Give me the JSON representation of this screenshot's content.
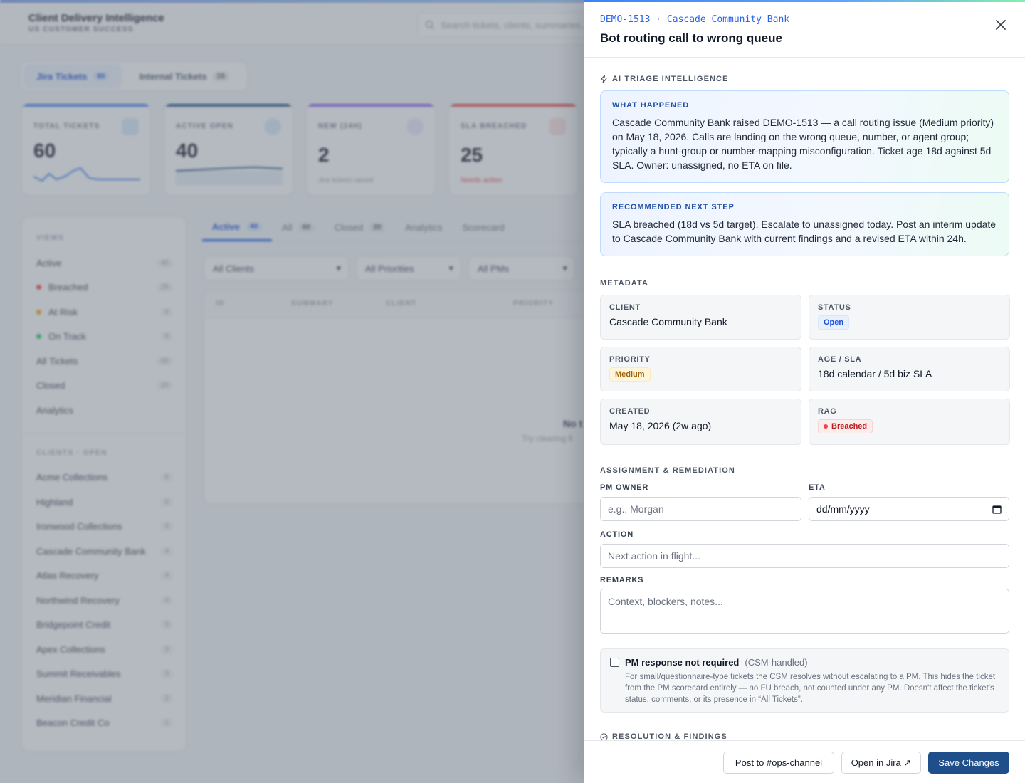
{
  "app": {
    "title": "Client Delivery Intelligence",
    "subtitle": "US CUSTOMER SUCCESS",
    "search_placeholder": "Search tickets, clients, summaries..."
  },
  "top_tabs": [
    {
      "label": "Jira Tickets",
      "count": "60"
    },
    {
      "label": "Internal Tickets",
      "count": "15"
    }
  ],
  "kpis": [
    {
      "label": "TOTAL TICKETS",
      "value": "60",
      "sub": "",
      "color": "#3b82f6"
    },
    {
      "label": "ACTIVE OPEN",
      "value": "40",
      "sub": "",
      "color": "#1e4f8a"
    },
    {
      "label": "NEW (24H)",
      "value": "2",
      "sub": "Jira tickets raised",
      "color": "#8b5cf6"
    },
    {
      "label": "SLA BREACHED",
      "value": "25",
      "sub": "Needs action",
      "color": "#ef4444"
    }
  ],
  "sidebar": {
    "views_heading": "VIEWS",
    "views": [
      {
        "label": "Active",
        "count": "40"
      },
      {
        "label": "Breached",
        "count": "25",
        "dot": "#ef4444"
      },
      {
        "label": "At Risk",
        "count": "6",
        "dot": "#f59e0b"
      },
      {
        "label": "On Track",
        "count": "9",
        "dot": "#22c55e"
      },
      {
        "label": "All Tickets",
        "count": "60"
      },
      {
        "label": "Closed",
        "count": "20"
      },
      {
        "label": "Analytics",
        "count": ""
      }
    ],
    "clients_heading": "CLIENTS · OPEN",
    "clients": [
      {
        "label": "Acme Collections",
        "count": "6"
      },
      {
        "label": "Highland",
        "count": "6"
      },
      {
        "label": "Ironwood Collections",
        "count": "4"
      },
      {
        "label": "Cascade Community Bank",
        "count": "4"
      },
      {
        "label": "Atlas Recovery",
        "count": "4"
      },
      {
        "label": "Northwind Recovery",
        "count": "4"
      },
      {
        "label": "Bridgepoint Credit",
        "count": "3"
      },
      {
        "label": "Apex Collections",
        "count": "3"
      },
      {
        "label": "Summit Receivables",
        "count": "3"
      },
      {
        "label": "Meridian Financial",
        "count": "2"
      },
      {
        "label": "Beacon Credit Co",
        "count": "1"
      }
    ]
  },
  "content_tabs": [
    {
      "label": "Active",
      "count": "40"
    },
    {
      "label": "All",
      "count": "60"
    },
    {
      "label": "Closed",
      "count": "20"
    },
    {
      "label": "Analytics",
      "count": ""
    },
    {
      "label": "Scorecard",
      "count": ""
    }
  ],
  "filters": [
    "All Clients",
    "All Priorities",
    "All PMs"
  ],
  "table": {
    "headers": [
      "ID",
      "SUMMARY",
      "CLIENT",
      "PRIORITY"
    ],
    "empty_title": "No t",
    "empty_sub": "Try clearing fi"
  },
  "drawer": {
    "key_line": "DEMO-1513 · Cascade Community Bank",
    "title": "Bot routing call to wrong queue",
    "ai_heading": "AI TRIAGE INTELLIGENCE",
    "what_happened_heading": "WHAT HAPPENED",
    "what_happened_text": "Cascade Community Bank raised DEMO-1513 — a call routing issue (Medium priority) on May 18, 2026. Calls are landing on the wrong queue, number, or agent group; typically a hunt-group or number-mapping misconfiguration. Ticket age 18d against 5d SLA. Owner: unassigned, no ETA on file.",
    "next_step_heading": "RECOMMENDED NEXT STEP",
    "next_step_text": "SLA breached (18d vs 5d target). Escalate to unassigned today. Post an interim update to Cascade Community Bank with current findings and a revised ETA within 24h.",
    "metadata_heading": "METADATA",
    "metadata": {
      "client_label": "CLIENT",
      "client_value": "Cascade Community Bank",
      "status_label": "STATUS",
      "status_value": "Open",
      "priority_label": "PRIORITY",
      "priority_value": "Medium",
      "age_label": "AGE / SLA",
      "age_value": "18d calendar / 5d biz SLA",
      "created_label": "CREATED",
      "created_value": "May 18, 2026 (2w ago)",
      "rag_label": "RAG",
      "rag_value": "Breached"
    },
    "assignment_heading": "ASSIGNMENT & REMEDIATION",
    "pm_owner_label": "PM OWNER",
    "pm_owner_placeholder": "e.g., Morgan",
    "eta_label": "ETA",
    "eta_placeholder": "dd/mm/yyyy",
    "action_label": "ACTION",
    "action_placeholder": "Next action in flight...",
    "remarks_label": "REMARKS",
    "remarks_placeholder": "Context, blockers, notes...",
    "pm_not_required_label": "PM response not required",
    "pm_not_required_suffix": "(CSM-handled)",
    "pm_not_required_desc": "For small/questionnaire-type tickets the CSM resolves without escalating to a PM. This hides the ticket from the PM scorecard entirely — no FU breach, not counted under any PM. Doesn't affect the ticket's status, comments, or its presence in “All Tickets”.",
    "resolution_heading": "RESOLUTION & FINDINGS",
    "buttons": {
      "post": "Post to #ops-channel",
      "jira": "Open in Jira ↗",
      "save": "Save Changes"
    }
  }
}
